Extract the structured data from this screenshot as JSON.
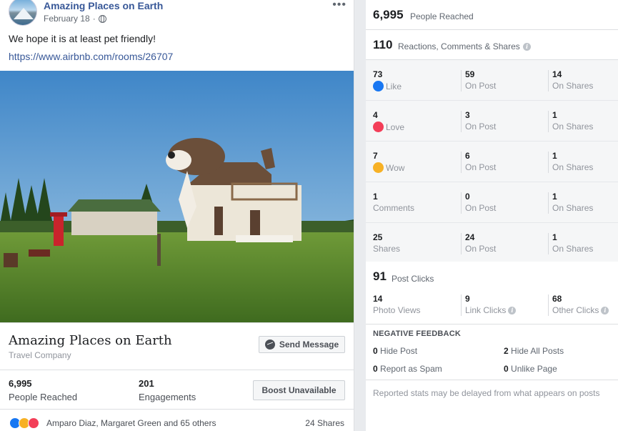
{
  "post": {
    "page_name": "Amazing Places on Earth",
    "date": "February 18",
    "separator": "·",
    "text": "We hope it is at least pet friendly!",
    "link": "https://www.airbnb.com/rooms/26707",
    "preview": {
      "title": "Amazing Places on Earth",
      "subtitle": "Travel Company",
      "send_button": "Send Message"
    },
    "stats": {
      "reached_value": "6,995",
      "reached_label": "People Reached",
      "engagements_value": "201",
      "engagements_label": "Engagements",
      "boost_button": "Boost Unavailable"
    },
    "reactions": {
      "names": "Amparo Diaz, Margaret Green and 65 others",
      "shares": "24 Shares",
      "icons": [
        "like-icon",
        "wow-icon",
        "love-icon"
      ]
    }
  },
  "insights": {
    "reached_value": "6,995",
    "reached_label": "People Reached",
    "rcs_value": "110",
    "rcs_label": "Reactions, Comments & Shares",
    "rows": [
      {
        "n1": "73",
        "l1": "Like",
        "icon": "like-icon",
        "n2": "59",
        "l2": "On Post",
        "n3": "14",
        "l3": "On Shares"
      },
      {
        "n1": "4",
        "l1": "Love",
        "icon": "love-icon",
        "n2": "3",
        "l2": "On Post",
        "n3": "1",
        "l3": "On Shares"
      },
      {
        "n1": "7",
        "l1": "Wow",
        "icon": "wow-icon",
        "n2": "6",
        "l2": "On Post",
        "n3": "1",
        "l3": "On Shares"
      },
      {
        "n1": "1",
        "l1": "Comments",
        "n2": "0",
        "l2": "On Post",
        "n3": "1",
        "l3": "On Shares"
      },
      {
        "n1": "25",
        "l1": "Shares",
        "n2": "24",
        "l2": "On Post",
        "n3": "1",
        "l3": "On Shares"
      }
    ],
    "post_clicks_value": "91",
    "post_clicks_label": "Post Clicks",
    "clicks": [
      {
        "n": "14",
        "l": "Photo Views"
      },
      {
        "n": "9",
        "l": "Link Clicks"
      },
      {
        "n": "68",
        "l": "Other Clicks"
      }
    ],
    "negative": {
      "title": "NEGATIVE FEEDBACK",
      "hide_post_n": "0",
      "hide_post_l": "Hide Post",
      "hide_all_n": "2",
      "hide_all_l": "Hide All Posts",
      "spam_n": "0",
      "spam_l": "Report as Spam",
      "unlike_n": "0",
      "unlike_l": "Unlike Page"
    },
    "footer_note": "Reported stats may be delayed from what appears on posts"
  },
  "colors": {
    "link_blue": "#385898",
    "like_blue": "#1877f2",
    "love_red": "#f33e58",
    "wow_yellow": "#f7b125",
    "panel_gray": "#f5f6f7"
  }
}
